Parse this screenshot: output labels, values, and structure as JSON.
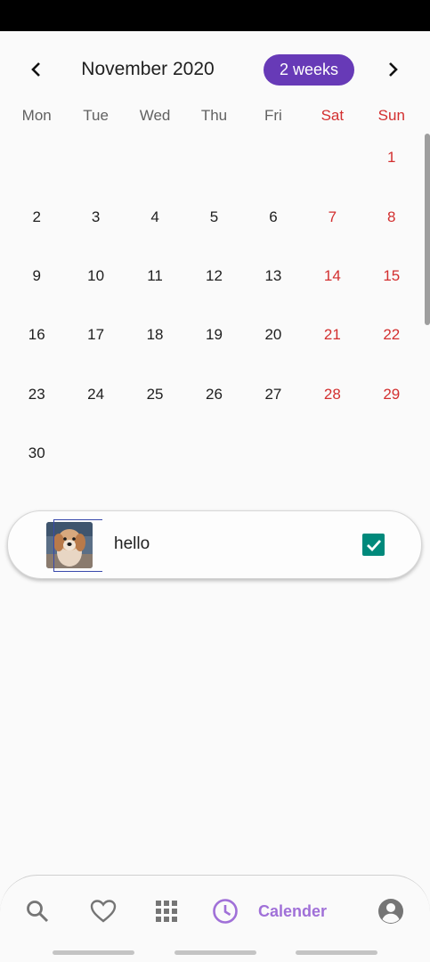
{
  "header": {
    "month_title": "November 2020",
    "format_button": "2 weeks"
  },
  "weekdays": [
    "Mon",
    "Tue",
    "Wed",
    "Thu",
    "Fri",
    "Sat",
    "Sun"
  ],
  "days": [
    [
      "",
      "",
      "",
      "",
      "",
      "",
      "1"
    ],
    [
      "2",
      "3",
      "4",
      "5",
      "6",
      "7",
      "8"
    ],
    [
      "9",
      "10",
      "11",
      "12",
      "13",
      "14",
      "15"
    ],
    [
      "16",
      "17",
      "18",
      "19",
      "20",
      "21",
      "22"
    ],
    [
      "23",
      "24",
      "25",
      "26",
      "27",
      "28",
      "29"
    ],
    [
      "30",
      "",
      "",
      "",
      "",
      "",
      ""
    ]
  ],
  "event": {
    "title": "hello",
    "completed": true,
    "thumbnail": "dog-photo"
  },
  "bottom_nav": {
    "items": [
      {
        "icon": "search-icon"
      },
      {
        "icon": "heart-icon"
      },
      {
        "icon": "grid-icon"
      },
      {
        "icon": "clock-icon",
        "label": "Calender",
        "active": true
      },
      {
        "icon": "account-icon"
      }
    ]
  },
  "colors": {
    "accent": "#673ab7",
    "weekend": "#d32f2f",
    "check": "#00897b",
    "active_nav": "#a070d8"
  }
}
